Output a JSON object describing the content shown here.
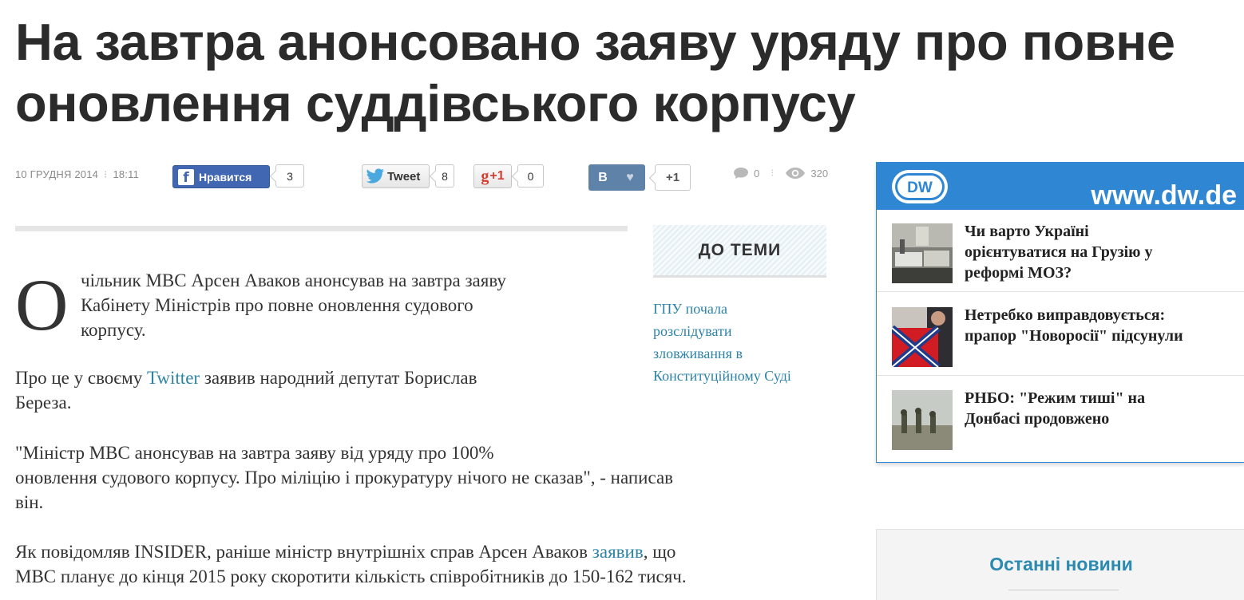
{
  "article": {
    "headline_line1": "На завтра анонсовано заяву уряду про повне",
    "headline_line2": "оновлення суддівського корпусу",
    "date": "10 ГРУДНЯ 2014",
    "time": "18:11",
    "dropcap": "О",
    "lead_line1": "чільник МВС Арсен Аваков анонсував на завтра заяву",
    "lead_line2": "Кабінету Міністрів про повне оновлення судового",
    "lead_line3": "корпусу.",
    "p2_before": "Про це у своєму ",
    "p2_link": "Twitter",
    "p2_after": " заявив народний депутат Борислав",
    "p2_line2": "Береза.",
    "p3_line1": "\"Міністр МВС анонсував на завтра заяву від уряду про 100%",
    "p3_line2": "оновлення судового корпусу. Про міліцію і прокуратуру нічого не сказав\", - написав",
    "p3_line3": "він.",
    "p4_before": "Як повідомляв INSIDER, раніше міністр внутрішніх справ Арсен Аваков ",
    "p4_link": "заявив",
    "p4_after": ", що",
    "p4_line2": "МВС планує до кінця 2015 року скоротити кількість співробітників до 150-162 тисяч."
  },
  "share": {
    "fb_label": "Нравится",
    "fb_count": "3",
    "tweet_label": "Tweet",
    "tweet_count": "8",
    "gplus_label": "+1",
    "gplus_count": "0",
    "vk_label": "В",
    "vk_plus": "+1",
    "comments": "0",
    "views": "320"
  },
  "related": {
    "heading": "ДО ТЕМИ",
    "link_line1": "ГПУ почала",
    "link_line2": "розслідувати",
    "link_line3": "зловживання в",
    "link_line4": "Конституційному Суді"
  },
  "dw": {
    "url": "www.dw.de",
    "items": [
      {
        "line1": "Чи варто Україні",
        "line2": "орієнтуватися на Грузію у",
        "line3": "реформі МОЗ?"
      },
      {
        "line1": "Нетребко виправдовується:",
        "line2": "прапор \"Новоросії\" підсунули",
        "line3": ""
      },
      {
        "line1": "РНБО: \"Режим тиші\" на",
        "line2": "Донбасі продовжено",
        "line3": ""
      }
    ]
  },
  "latest": {
    "title": "Останні новини"
  },
  "colors": {
    "link": "#2d83a7",
    "dw_blue": "#2f86d2",
    "fb_blue": "#4267b2",
    "vk_blue": "#5e82a8"
  }
}
